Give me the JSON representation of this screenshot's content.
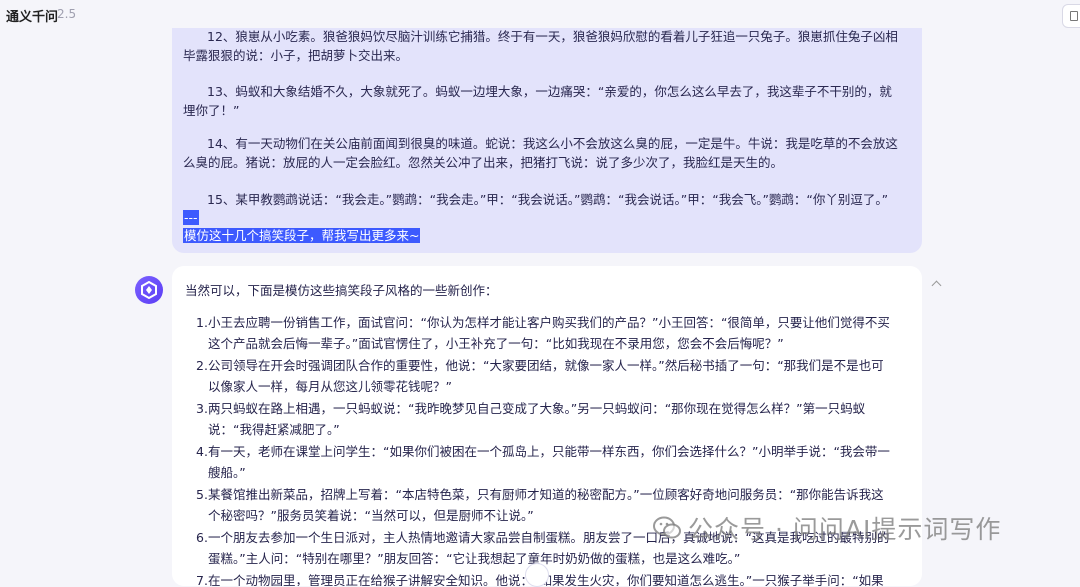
{
  "header": {
    "app_title": "通义千问",
    "version": "2.5"
  },
  "user_message": {
    "paragraphs": [
      "12、狼崽从小吃素。狼爸狼妈饮尽脑汁训练它捕猎。终于有一天，狼爸狼妈欣慰的看着儿子狂追一只兔子。狼崽抓住兔子凶相毕露狠狠的说：小子，把胡萝卜交出来。",
      "13、蚂蚁和大象结婚不久，大象就死了。蚂蚁一边埋大象，一边痛哭：“亲爱的，你怎么这么早去了，我这辈子不干别的，就埋你了！”",
      "14、有一天动物们在关公庙前面闻到很臭的味道。蛇说：我这么小不会放这么臭的屁，一定是牛。牛说：我是吃草的不会放这么臭的屁。猪说：放屁的人一定会脸红。忽然关公冲了出来，把猪打飞说：说了多少次了，我脸红是天生的。",
      "15、某甲教鹦鹉说话：“我会走。”鹦鹉：“我会走。”甲：“我会说话。”鹦鹉：“我会说话。”甲：“我会飞。”鹦鹉：“你丫别逗了。”"
    ],
    "separator": "---",
    "request": "模仿这十几个搞笑段子，帮我写出更多来~"
  },
  "ai_response": {
    "intro": "当然可以，下面是模仿这些搞笑段子风格的一些新创作：",
    "items": [
      {
        "num": "1.",
        "text": "小王去应聘一份销售工作，面试官问：“你认为怎样才能让客户购买我们的产品？”小王回答：“很简单，只要让他们觉得不买这个产品就会后悔一辈子。”面试官愣住了，小王补充了一句：“比如我现在不录用您，您会不会后悔呢？”"
      },
      {
        "num": "2.",
        "text": "公司领导在开会时强调团队合作的重要性，他说：“大家要团结，就像一家人一样。”然后秘书插了一句：“那我们是不是也可以像家人一样，每月从您这儿领零花钱呢？”"
      },
      {
        "num": "3.",
        "text": "两只蚂蚁在路上相遇，一只蚂蚁说：“我昨晚梦见自己变成了大象。”另一只蚂蚁问：“那你现在觉得怎么样？”第一只蚂蚁说：“我得赶紧减肥了。”"
      },
      {
        "num": "4.",
        "text": "有一天，老师在课堂上问学生：“如果你们被困在一个孤岛上，只能带一样东西，你们会选择什么？”小明举手说：“我会带一艘船。”"
      },
      {
        "num": "5.",
        "text": "某餐馆推出新菜品，招牌上写着：“本店特色菜，只有厨师才知道的秘密配方。”一位顾客好奇地问服务员：“那你能告诉我这个秘密吗？”服务员笑着说：“当然可以，但是厨师不让说。”"
      },
      {
        "num": "6.",
        "text": "一个朋友去参加一个生日派对，主人热情地邀请大家品尝自制蛋糕。朋友尝了一口后，真诚地说：“这真是我吃过的最特别的蛋糕。”主人问：“特别在哪里？”朋友回答：“它让我想起了童年时奶奶做的蛋糕，也是这么难吃。”"
      },
      {
        "num": "7.",
        "text": "在一个动物园里，管理员正在给猴子讲解安全知识。他说：“如果发生火灾，你们要知道怎么逃生。”一只猴子举手问：“如果我们学会了逃生，那还用住在笼子里吗？”"
      }
    ]
  },
  "watermark": {
    "text": "公众号 · 问问AI提示词写作"
  },
  "colors": {
    "user_bubble": "#e3e3fb",
    "highlight": "#3d5afe",
    "avatar": "#6a4cff",
    "page_bg": "#f5f5fa"
  },
  "icons": [
    "chat-toggle-icon",
    "qwen-logo-icon",
    "collapse-chevron-icon",
    "wechat-icon",
    "scroll-down-icon"
  ]
}
